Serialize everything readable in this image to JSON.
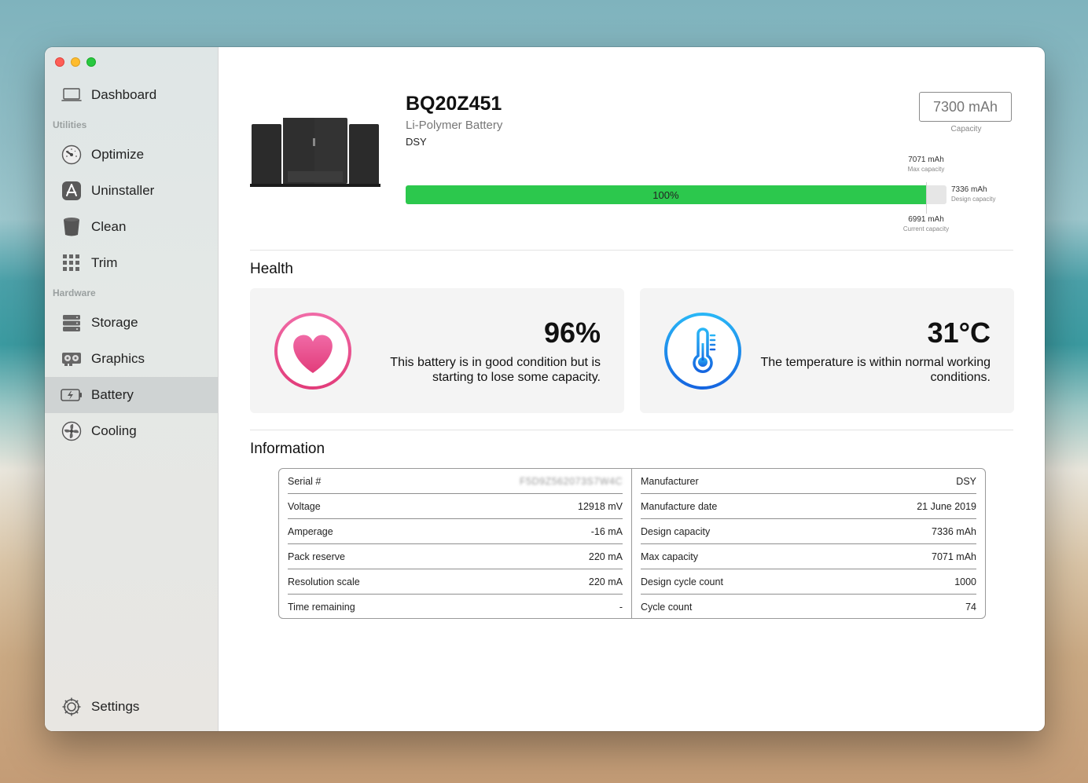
{
  "sidebar": {
    "items": [
      {
        "label": "Dashboard",
        "icon": "laptop-icon"
      },
      {
        "label": "Optimize",
        "icon": "gauge-icon"
      },
      {
        "label": "Uninstaller",
        "icon": "app-store-icon"
      },
      {
        "label": "Clean",
        "icon": "trash-icon"
      },
      {
        "label": "Trim",
        "icon": "grid-icon"
      },
      {
        "label": "Storage",
        "icon": "storage-icon"
      },
      {
        "label": "Graphics",
        "icon": "graphics-card-icon"
      },
      {
        "label": "Battery",
        "icon": "battery-icon",
        "active": true
      },
      {
        "label": "Cooling",
        "icon": "fan-icon"
      },
      {
        "label": "Settings",
        "icon": "gear-icon"
      }
    ],
    "sections": {
      "utilities": "Utilities",
      "hardware": "Hardware"
    }
  },
  "battery": {
    "model": "BQ20Z451",
    "type": "Li-Polymer Battery",
    "manufacturer": "DSY",
    "capacity_value": "7300 mAh",
    "capacity_label": "Capacity",
    "bar_percent_label": "100%",
    "bar_fill_fraction": 0.962,
    "max_capacity": {
      "value": "7071 mAh",
      "label": "Max capacity"
    },
    "design_capacity": {
      "value": "7336 mAh",
      "label": "Design capacity"
    },
    "current_capacity": {
      "value": "6991 mAh",
      "label": "Current capacity"
    }
  },
  "health": {
    "title": "Health",
    "battery_card": {
      "value": "96%",
      "text": "This battery is in good condition but is starting to lose some capacity.",
      "icon": "heart-icon",
      "color": "#e8458a"
    },
    "temperature_card": {
      "value": "31°C",
      "text": "The temperature is within normal working conditions.",
      "icon": "thermometer-icon",
      "color": "#1a8ce6"
    }
  },
  "information": {
    "title": "Information",
    "left": [
      {
        "label": "Serial #",
        "value": "F5D9Z562073S7W4C"
      },
      {
        "label": "Voltage",
        "value": "12918 mV"
      },
      {
        "label": "Amperage",
        "value": "-16 mA"
      },
      {
        "label": "Pack reserve",
        "value": "220 mA"
      },
      {
        "label": "Resolution scale",
        "value": "220 mA"
      },
      {
        "label": "Time remaining",
        "value": "-"
      }
    ],
    "right": [
      {
        "label": "Manufacturer",
        "value": "DSY"
      },
      {
        "label": "Manufacture date",
        "value": "21 June 2019"
      },
      {
        "label": "Design capacity",
        "value": "7336 mAh"
      },
      {
        "label": "Max capacity",
        "value": "7071 mAh"
      },
      {
        "label": "Design cycle count",
        "value": "1000"
      },
      {
        "label": "Cycle count",
        "value": "74"
      }
    ]
  },
  "colors": {
    "accent_green": "#2cc84d",
    "heart_pink": "#e8458a",
    "thermo_blue": "#1a8ce6"
  }
}
